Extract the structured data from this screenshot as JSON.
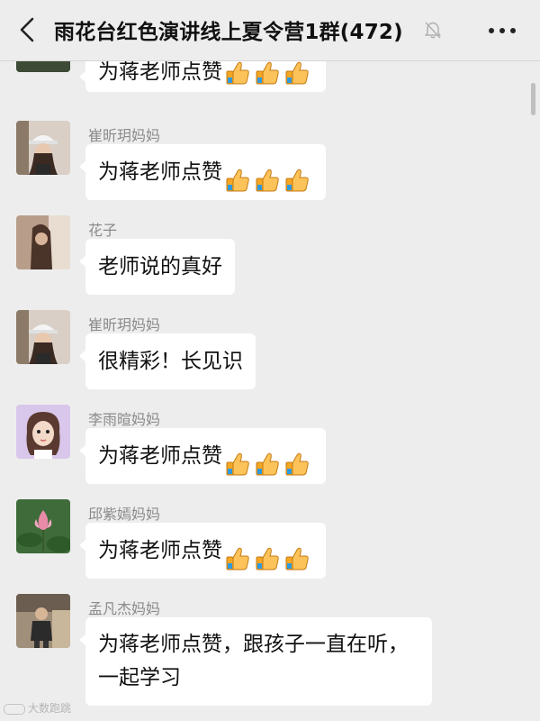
{
  "header": {
    "title": "雨花台红色演讲线上夏令营1群(472)"
  },
  "messages": [
    {
      "sender": "",
      "text": "为蒋老师点赞",
      "thumbs": 3
    },
    {
      "sender": "崔昕玥妈妈",
      "text": "为蒋老师点赞",
      "thumbs": 3
    },
    {
      "sender": "花子",
      "text": "老师说的真好",
      "thumbs": 0
    },
    {
      "sender": "崔昕玥妈妈",
      "text": "很精彩！长见识",
      "thumbs": 0
    },
    {
      "sender": "李雨暄妈妈",
      "text": "为蒋老师点赞",
      "thumbs": 3
    },
    {
      "sender": "邱紫嫣妈妈",
      "text": "为蒋老师点赞",
      "thumbs": 3
    },
    {
      "sender": "孟凡杰妈妈",
      "text": "为蒋老师点赞，跟孩子一直在听，\n一起学习",
      "thumbs": 0
    }
  ],
  "watermark": "大数跑跳",
  "icons": {
    "back": "chevron-left-icon",
    "mute": "bell-muted-icon",
    "more": "more-dots-icon",
    "thumb": "thumbs-up-emoji-icon"
  },
  "colors": {
    "background": "#ededed",
    "bubble": "#ffffff",
    "sender": "#8a8a8a"
  }
}
